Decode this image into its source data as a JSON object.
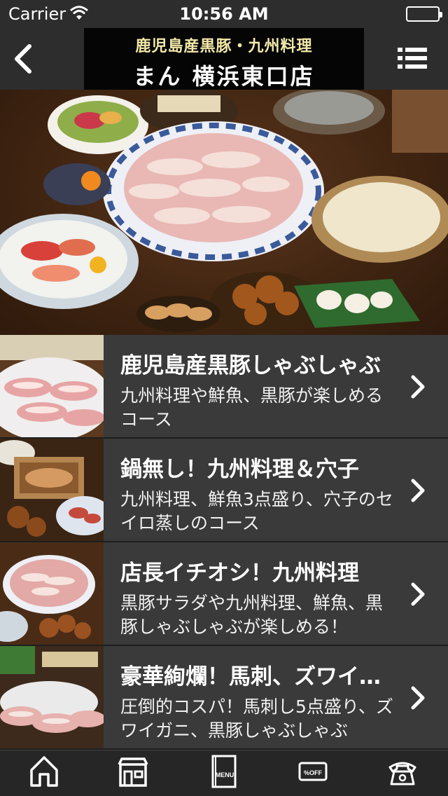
{
  "status_bar": {
    "carrier": "Carrier",
    "time": "10:56 AM",
    "wifi_icon": "wifi-icon",
    "battery_icon": "battery-icon"
  },
  "nav": {
    "back_icon": "chevron-left-icon",
    "menu_icon": "list-icon",
    "logo_line1": "鹿児島産黒豚・九州料理",
    "logo_line2": "まん 横浜東口店"
  },
  "hero": {
    "image": "course-food-spread-photo"
  },
  "courses": [
    {
      "title": "鹿児島産黒豚しゃぶしゃぶ",
      "description": "九州料理や鮮魚、黒豚が楽しめるコース",
      "thumb": "pork-shabu-photo"
    },
    {
      "title": "鍋無し！九州料理＆穴子",
      "description": "九州料理、鮮魚3点盛り、穴子のセイロ蒸しのコース",
      "thumb": "seiro-steam-photo"
    },
    {
      "title": "店長イチオシ！九州料理",
      "description": "黒豚サラダや九州料理、鮮魚、黒豚しゃぶしゃぶが楽しめる！",
      "thumb": "full-course-photo"
    },
    {
      "title": "豪華絢爛！馬刺、ズワイガニ",
      "description": "圧倒的コスパ！馬刺し5点盛り、ズワイガニ、黒豚しゃぶしゃぶ",
      "thumb": "luxury-course-photo"
    }
  ],
  "tabs": [
    {
      "name": "home",
      "icon": "home-icon"
    },
    {
      "name": "shop",
      "icon": "shop-icon"
    },
    {
      "name": "menu",
      "icon": "menu-book-icon",
      "label": "MENU"
    },
    {
      "name": "coupon",
      "icon": "coupon-icon",
      "label": "%OFF"
    },
    {
      "name": "phone",
      "icon": "phone-icon"
    }
  ],
  "colors": {
    "background": "#2b2b2b",
    "list_row": "#3a3a3a",
    "logo_bg": "#050505",
    "logo_accent": "#f3e9a8"
  }
}
